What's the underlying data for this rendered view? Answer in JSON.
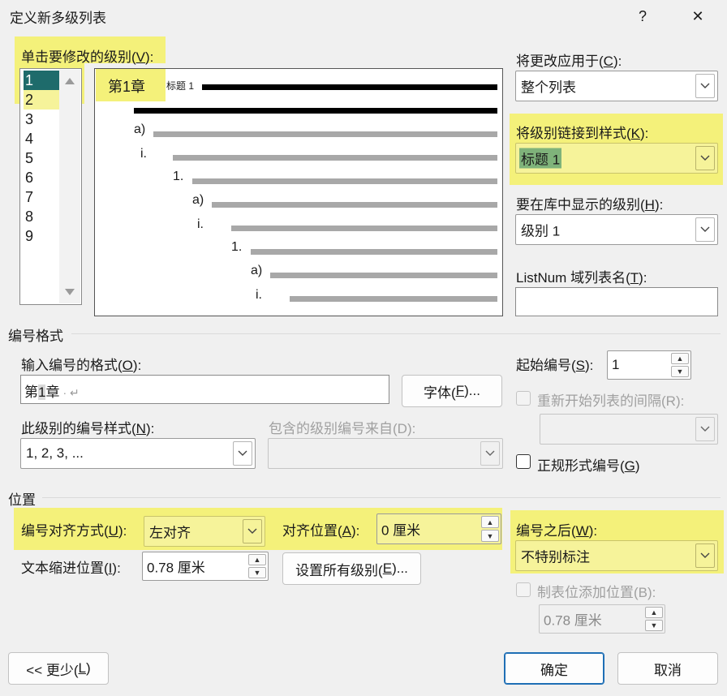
{
  "window": {
    "title": "定义新多级列表",
    "help_symbol": "?",
    "close_symbol": "✕"
  },
  "levels": {
    "label": "单击要修改的级别(",
    "label_key": "V",
    "label_end": "):",
    "items": [
      "1",
      "2",
      "3",
      "4",
      "5",
      "6",
      "7",
      "8",
      "9"
    ],
    "selected": "1"
  },
  "preview": {
    "level1_number": "第1章",
    "level1_style": "标题 1",
    "sub_labels": [
      "a)",
      "i.",
      "1.",
      "a)",
      "i.",
      "1.",
      "a)",
      "i."
    ]
  },
  "right_panel": {
    "apply_to_label": "将更改应用于(",
    "apply_to_key": "C",
    "apply_to_end": "):",
    "apply_to_value": "整个列表",
    "link_style_label": "将级别链接到样式(",
    "link_style_key": "K",
    "link_style_end": "):",
    "link_style_value": "标题 1",
    "gallery_level_label": "要在库中显示的级别(",
    "gallery_level_key": "H",
    "gallery_level_end": "):",
    "gallery_level_value": "级别 1",
    "listnum_label": "ListNum 域列表名(",
    "listnum_key": "T",
    "listnum_end": "):",
    "listnum_value": ""
  },
  "number_format": {
    "section_title": "编号格式",
    "enter_format_label": "输入编号的格式(",
    "enter_format_key": "O",
    "enter_format_end": "):",
    "format_pre": "第",
    "format_num": "1",
    "format_post": "章",
    "format_mark": "· ↵",
    "font_button": "字体(",
    "font_key": "F",
    "font_end": ")...",
    "style_label": "此级别的编号样式(",
    "style_key": "N",
    "style_end": "):",
    "style_value": "1, 2, 3, ...",
    "include_label": "包含的级别编号来自(D):",
    "include_value": "",
    "start_at_label": "起始编号(",
    "start_at_key": "S",
    "start_at_end": "):",
    "start_at_value": "1",
    "restart_label": "重新开始列表的间隔(R):",
    "restart_value": "",
    "legal_label": "正规形式编号(",
    "legal_key": "G",
    "legal_end": ")"
  },
  "position": {
    "section_title": "位置",
    "alignment_label": "编号对齐方式(",
    "alignment_key": "U",
    "alignment_end": "):",
    "alignment_value": "左对齐",
    "aligned_at_label": "对齐位置(",
    "aligned_at_key": "A",
    "aligned_at_end": "):",
    "aligned_at_value": "0 厘米",
    "indent_label": "文本缩进位置(",
    "indent_key": "I",
    "indent_end": "):",
    "indent_value": "0.78 厘米",
    "set_all_button": "设置所有级别(",
    "set_all_key": "E",
    "set_all_end": ")...",
    "follow_label": "编号之后(",
    "follow_key": "W",
    "follow_end": "):",
    "follow_value": "不特别标注",
    "tab_stop_label": "制表位添加位置(B):",
    "tab_stop_value": "0.78 厘米"
  },
  "footer": {
    "less_button": "<< 更少(",
    "less_key": "L",
    "less_end": ")",
    "ok_button": "确定",
    "cancel_button": "取消"
  },
  "colors": {
    "highlight": "#f4f17a",
    "selection": "#1e6b6b",
    "primary_border": "#1f6fb5"
  }
}
